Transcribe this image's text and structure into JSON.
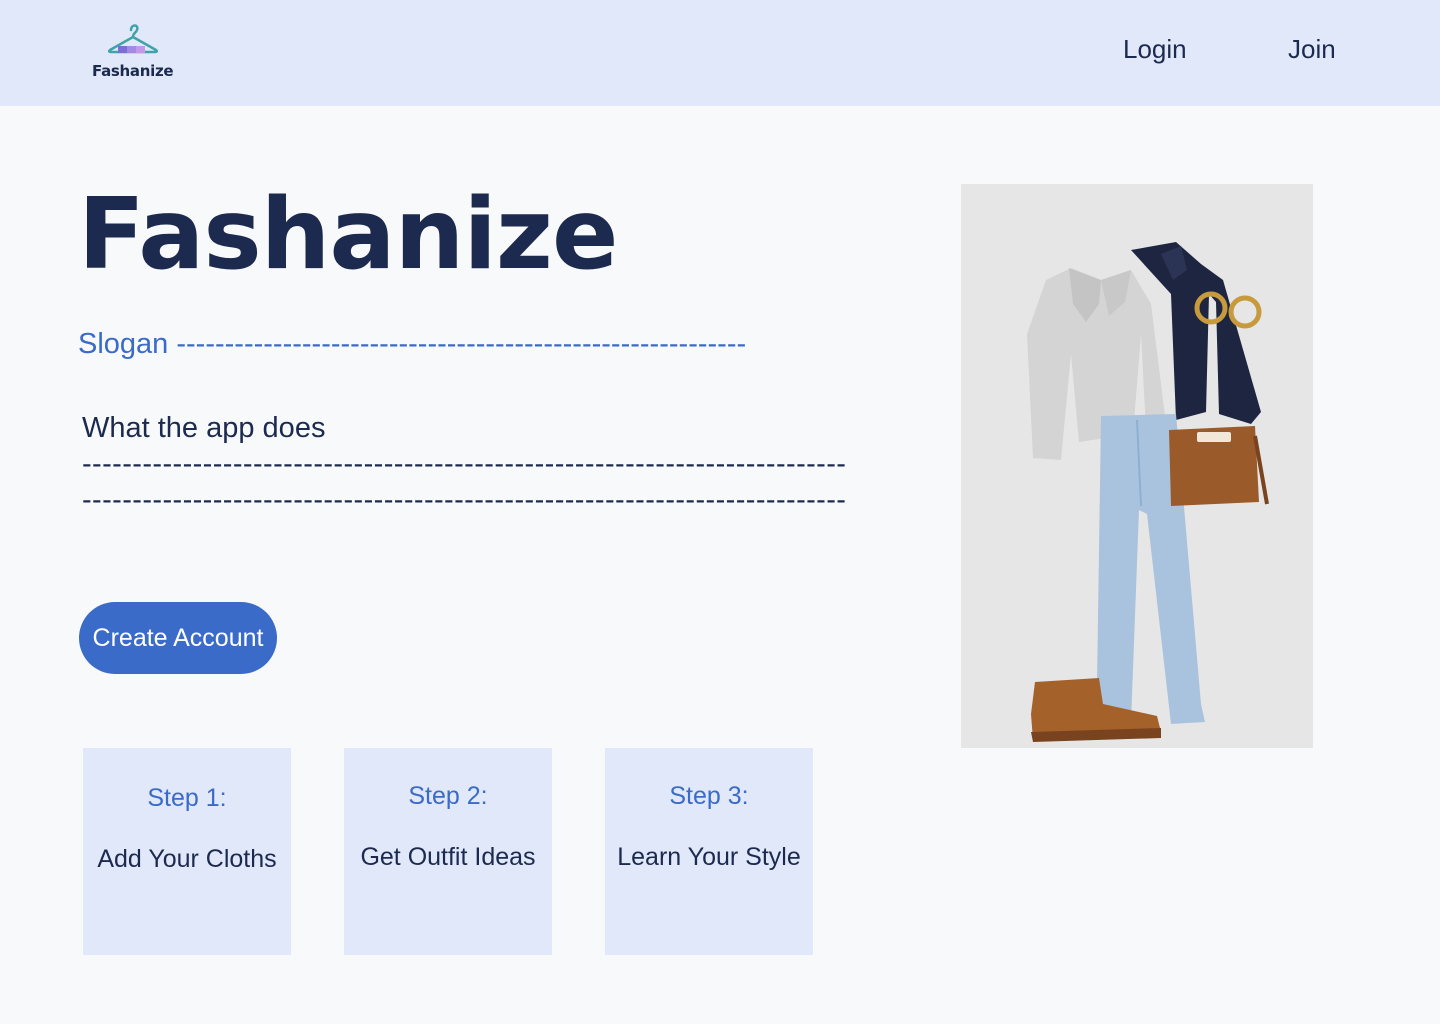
{
  "header": {
    "logo_text": "Fashanize",
    "nav": {
      "login_label": "Login",
      "join_label": "Join"
    }
  },
  "hero": {
    "title": "Fashanize",
    "slogan": "Slogan -----------------------------------------------------------",
    "description_heading": "What the app does",
    "description_line_1": "----------------------------------------------------------------------------",
    "description_line_2": "----------------------------------------------------------------------------",
    "cta_label": "Create Account"
  },
  "steps": [
    {
      "label": "Step 1:",
      "text": "Add Your Cloths"
    },
    {
      "label": "Step 2:",
      "text": "Get Outfit Ideas"
    },
    {
      "label": "Step 3:",
      "text": "Learn Your Style"
    }
  ],
  "colors": {
    "header_bg": "#e1e8fa",
    "accent": "#3a6bc9",
    "text_dark": "#1b2a4e",
    "card_bg": "#e1e8fa"
  },
  "icons": {
    "logo": "hanger-icon"
  }
}
